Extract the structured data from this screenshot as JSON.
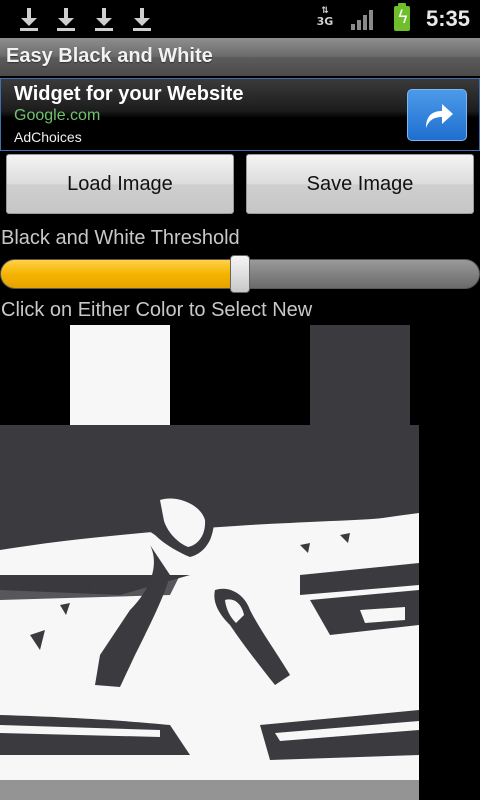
{
  "status_bar": {
    "icons": [
      "download-icon",
      "download-icon",
      "download-icon",
      "download-icon",
      "network-3g-icon",
      "signal-icon",
      "battery-charging-icon"
    ],
    "network_label": "3G",
    "time": "5:35"
  },
  "app": {
    "title": "Easy Black and White"
  },
  "ad": {
    "title": "Widget for your Website",
    "url": "Google.com",
    "choices": "AdChoices",
    "button_icon": "share-arrow-icon"
  },
  "buttons": {
    "load": "Load Image",
    "save": "Save Image"
  },
  "threshold": {
    "label": "Black and White Threshold",
    "value_percent": 50
  },
  "color_select": {
    "label": "Click on Either Color to Select New",
    "colors": {
      "white": "#f7f7f7",
      "dark": "#3b3a3e"
    }
  },
  "colors": {
    "slider_fill": "#f5b400",
    "ad_url": "#6fc36a",
    "ad_button": "#1f6fd0"
  }
}
